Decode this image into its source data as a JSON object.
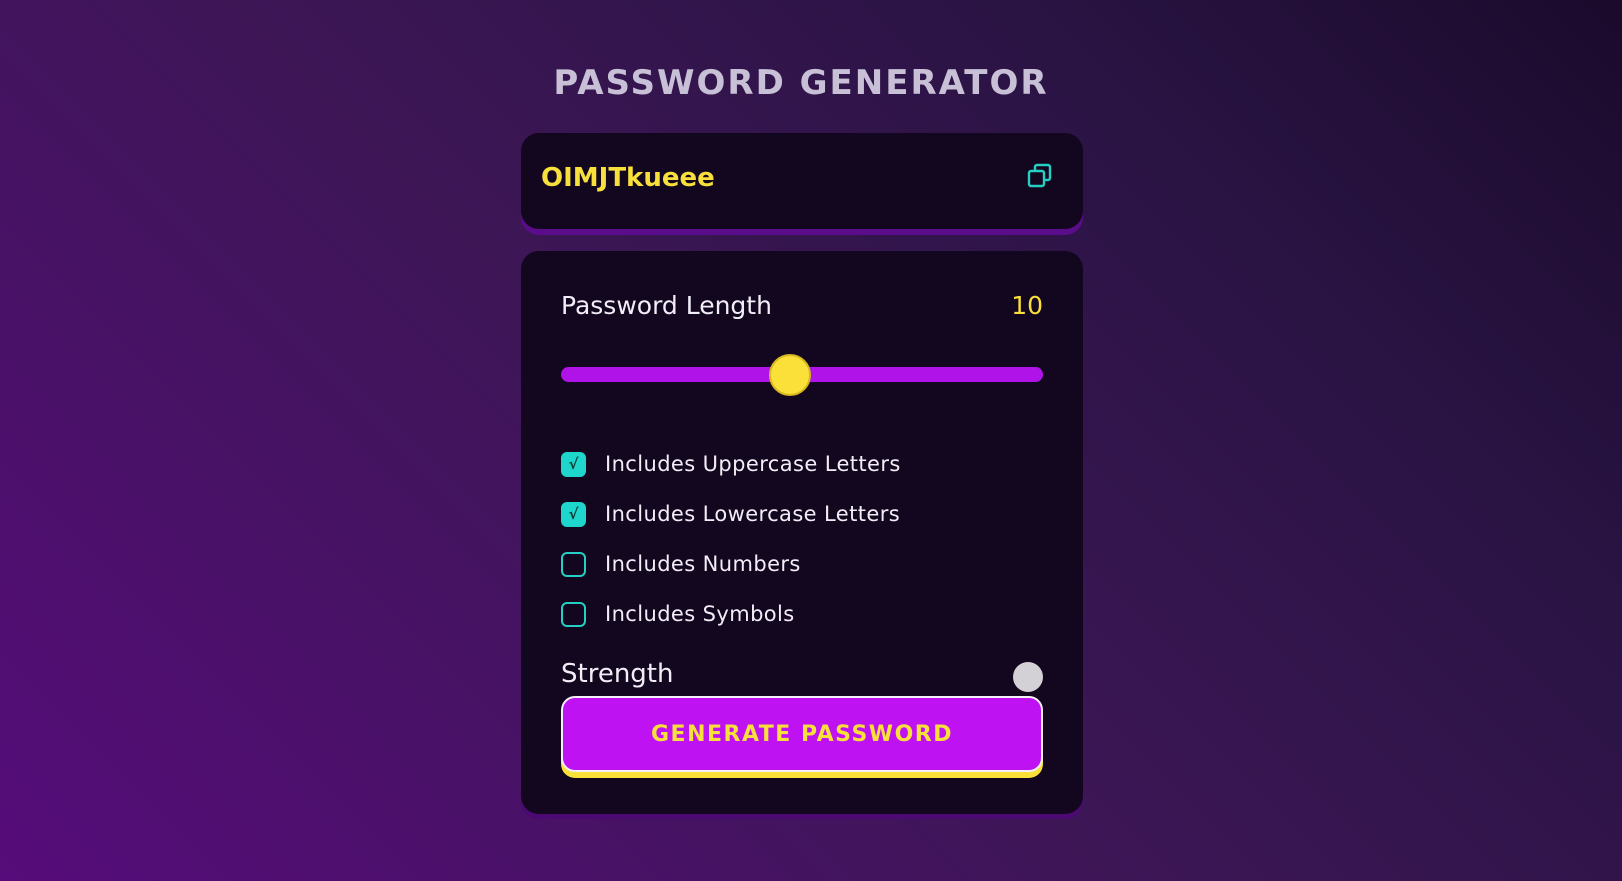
{
  "app": {
    "title": "PASSWORD GENERATOR"
  },
  "display": {
    "password": "OIMJTkueee",
    "copy_icon": "copy-icon"
  },
  "settings": {
    "length_label": "Password Length",
    "length_value": "10",
    "slider_fill_fraction": 0.475,
    "options": [
      {
        "label": "Includes Uppercase Letters",
        "checked": true
      },
      {
        "label": "Includes Lowercase Letters",
        "checked": true
      },
      {
        "label": "Includes Numbers",
        "checked": false
      },
      {
        "label": "Includes Symbols",
        "checked": false
      }
    ],
    "strength_label": "Strength",
    "generate_label": "GENERATE PASSWORD"
  },
  "colors": {
    "accent_yellow": "#f7df3c",
    "accent_purple": "#bf12f2",
    "accent_teal": "#1ed6cc",
    "card_bg": "#13061f"
  }
}
